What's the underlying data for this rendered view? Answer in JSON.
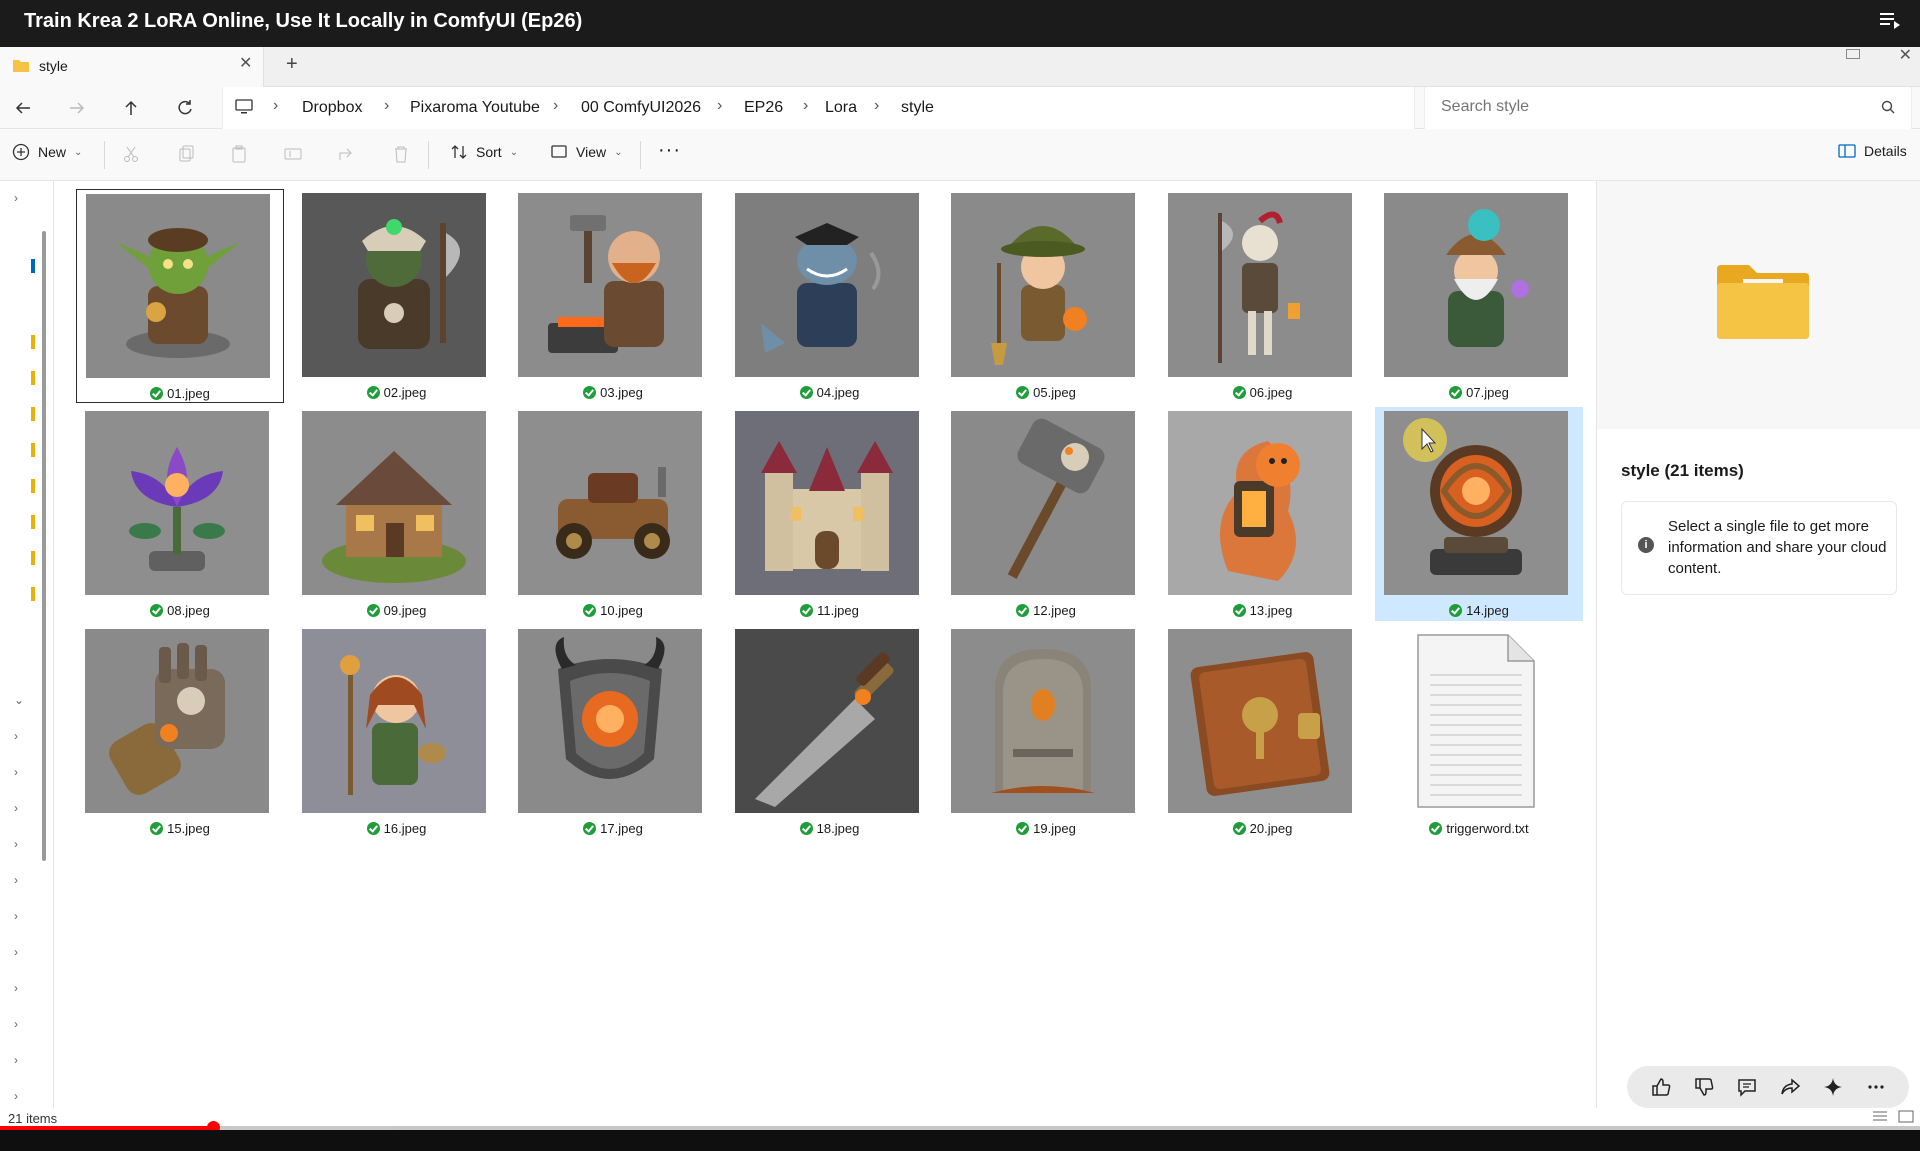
{
  "video": {
    "title": "Train Krea 2 LoRA Online, Use It Locally in ComfyUI (Ep26)",
    "progress_fraction": 0.111,
    "buffered_fraction": 0.205
  },
  "tab": {
    "label": "style"
  },
  "breadcrumb": [
    "Dropbox",
    "Pixaroma Youtube",
    "00 ComfyUI2026",
    "EP26",
    "Lora",
    "style"
  ],
  "search": {
    "placeholder": "Search style"
  },
  "toolbar": {
    "new_label": "New",
    "sort_label": "Sort",
    "view_label": "View",
    "details_label": "Details"
  },
  "files": [
    {
      "name": "01.jpeg",
      "art": "goblin"
    },
    {
      "name": "02.jpeg",
      "art": "orc"
    },
    {
      "name": "03.jpeg",
      "art": "dwarf"
    },
    {
      "name": "04.jpeg",
      "art": "shark"
    },
    {
      "name": "05.jpeg",
      "art": "witch"
    },
    {
      "name": "06.jpeg",
      "art": "skeleton"
    },
    {
      "name": "07.jpeg",
      "art": "gnome"
    },
    {
      "name": "08.jpeg",
      "art": "lotus"
    },
    {
      "name": "09.jpeg",
      "art": "cottage"
    },
    {
      "name": "10.jpeg",
      "art": "car"
    },
    {
      "name": "11.jpeg",
      "art": "castle"
    },
    {
      "name": "12.jpeg",
      "art": "hammer"
    },
    {
      "name": "13.jpeg",
      "art": "lantern"
    },
    {
      "name": "14.jpeg",
      "art": "orb"
    },
    {
      "name": "15.jpeg",
      "art": "gauntlet"
    },
    {
      "name": "16.jpeg",
      "art": "girl"
    },
    {
      "name": "17.jpeg",
      "art": "shield"
    },
    {
      "name": "18.jpeg",
      "art": "sword"
    },
    {
      "name": "19.jpeg",
      "art": "tombstone"
    },
    {
      "name": "20.jpeg",
      "art": "book"
    },
    {
      "name": "triggerword.txt",
      "art": "textfile"
    }
  ],
  "focused_file": "01.jpeg",
  "selected_file": "14.jpeg",
  "details": {
    "title": "style (21 items)",
    "info": "Select a single file to get more information and share your cloud content."
  },
  "status": {
    "item_count": "21 items"
  },
  "colors": {
    "sync_green": "#1f9d3a",
    "progress_red": "#ff0000",
    "folder_yellow": "#f6c445",
    "selection_blue": "#cde8ff"
  }
}
